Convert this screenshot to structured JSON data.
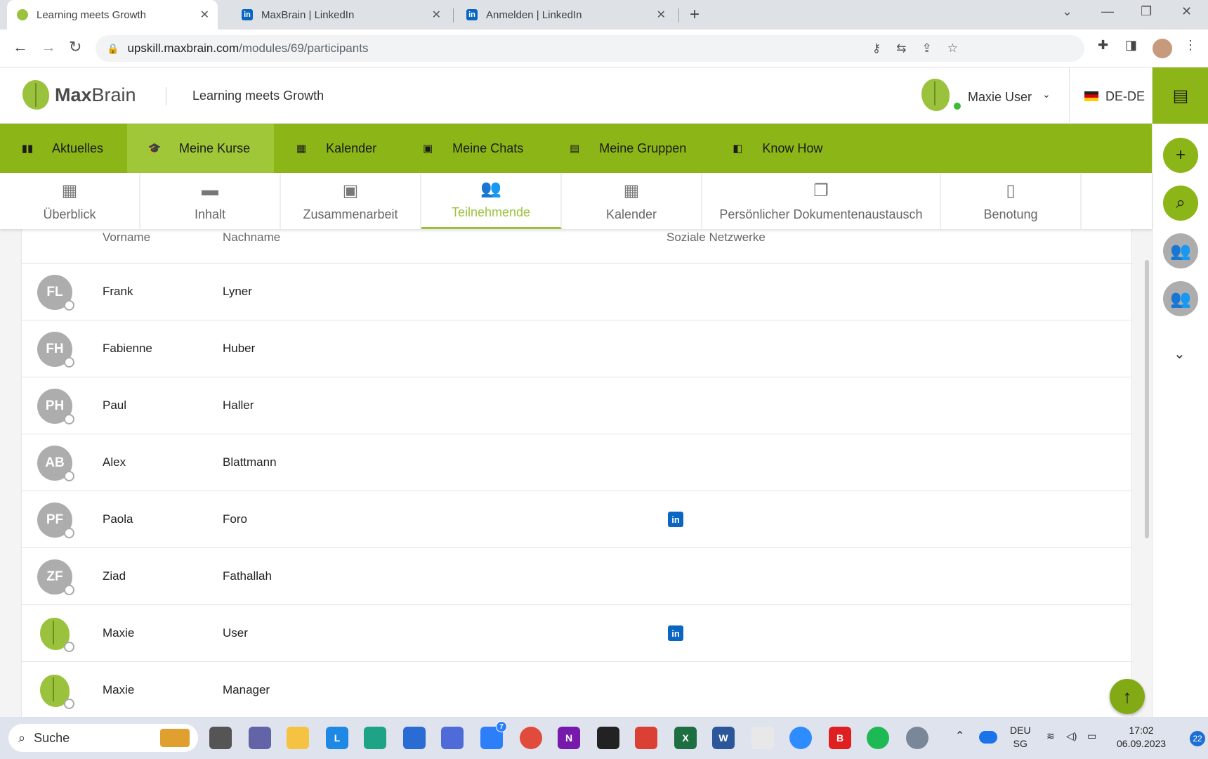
{
  "browser": {
    "tabs": [
      {
        "title": "Learning meets Growth",
        "active": true
      },
      {
        "title": "MaxBrain | LinkedIn",
        "active": false
      },
      {
        "title": "Anmelden | LinkedIn",
        "active": false
      }
    ],
    "url_domain": "upskill.maxbrain.com",
    "url_path": "/modules/69/participants"
  },
  "header": {
    "logo_bold": "Max",
    "logo_rest": "Brain",
    "title": "Learning meets Growth",
    "user_name": "Maxie User",
    "language": "DE-DE"
  },
  "main_nav": [
    {
      "label": "Aktuelles",
      "icon": "▮▮",
      "active": false
    },
    {
      "label": "Meine Kurse",
      "icon": "🎓",
      "active": true
    },
    {
      "label": "Kalender",
      "icon": "▦",
      "active": false
    },
    {
      "label": "Meine Chats",
      "icon": "▣",
      "active": false
    },
    {
      "label": "Meine Gruppen",
      "icon": "▤",
      "active": false
    },
    {
      "label": "Know How",
      "icon": "◧",
      "active": false
    }
  ],
  "sub_tabs": [
    {
      "label": "Überblick",
      "icon": "▦",
      "active": false
    },
    {
      "label": "Inhalt",
      "icon": "▬",
      "active": false
    },
    {
      "label": "Zusammenarbeit",
      "icon": "▣",
      "active": false
    },
    {
      "label": "Teilnehmende",
      "icon": "👥",
      "active": true
    },
    {
      "label": "Kalender",
      "icon": "▦",
      "active": false
    },
    {
      "label": "Persönlicher Dokumentenaustausch",
      "icon": "❐",
      "active": false
    },
    {
      "label": "Benotung",
      "icon": "▯",
      "active": false
    }
  ],
  "table": {
    "headers": {
      "firstname": "Vorname",
      "lastname": "Nachname",
      "social": "Soziale Netzwerke"
    },
    "rows": [
      {
        "initials": "FL",
        "firstname": "Frank",
        "lastname": "Lyner",
        "linkedin": false,
        "brain_avatar": false
      },
      {
        "initials": "FH",
        "firstname": "Fabienne",
        "lastname": "Huber",
        "linkedin": false,
        "brain_avatar": false
      },
      {
        "initials": "PH",
        "firstname": "Paul",
        "lastname": "Haller",
        "linkedin": false,
        "brain_avatar": false
      },
      {
        "initials": "AB",
        "firstname": "Alex",
        "lastname": "Blattmann",
        "linkedin": false,
        "brain_avatar": false
      },
      {
        "initials": "PF",
        "firstname": "Paola",
        "lastname": "Foro",
        "linkedin": true,
        "brain_avatar": false
      },
      {
        "initials": "ZF",
        "firstname": "Ziad",
        "lastname": "Fathallah",
        "linkedin": false,
        "brain_avatar": false
      },
      {
        "initials": "",
        "firstname": "Maxie",
        "lastname": "User",
        "linkedin": true,
        "brain_avatar": true
      },
      {
        "initials": "",
        "firstname": "Maxie",
        "lastname": "Manager",
        "linkedin": false,
        "brain_avatar": true
      }
    ],
    "linkedin_glyph": "in"
  },
  "taskbar": {
    "search_label": "Suche",
    "lang_top": "DEU",
    "lang_bottom": "SG",
    "time": "17:02",
    "date": "06.09.2023",
    "notifications": "22",
    "badge": "7"
  },
  "colors": {
    "brand_green": "#8cb517",
    "active_green": "#9bc23c",
    "linkedin": "#0a66c2"
  }
}
